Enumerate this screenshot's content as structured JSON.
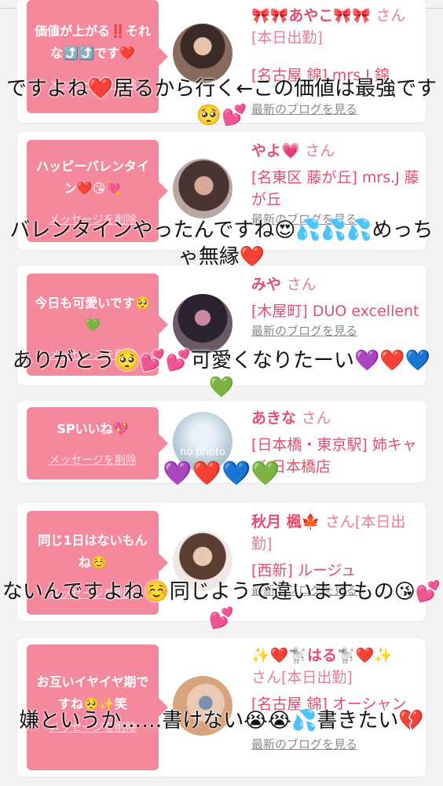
{
  "accent_color": "#f4899e",
  "link_color": "#e24e6f",
  "delete_label": "メッセージを削除",
  "blog_label": "最新のブログを見る",
  "cards": [
    {
      "message": "価値が上がる‼️それな⤴️⤴️です❤️",
      "name": "🎀🎀あやこ🎀🎀",
      "san": "さん[本日出勤]",
      "shop": "[名古屋 錦] mrs.J 錦",
      "overlay": "ですよね❤️居るから行く←この価値は最強です🥺💕"
    },
    {
      "message": "ハッピーバレンタイン❤️😘💘",
      "name": "やよ💗",
      "san": "さん",
      "shop": "[名東区 藤が丘] mrs.J 藤が丘",
      "overlay": "バレンタインやったんですね😍💦💦💦めっちゃ無縁❤️"
    },
    {
      "message": "今日も可愛いです🥺💚",
      "name": "みや",
      "san": "さん",
      "shop": "[木屋町] DUO excellent",
      "overlay": "ありがとう🥺💕💕可愛くなりたーい💜❤️💙💚"
    },
    {
      "message": "SPいいね💖",
      "name": "あきな",
      "san": "さん",
      "shop": "[日本橋・東京駅] 姉キャバ 日本橋店",
      "avatar_text": "no photo",
      "overlay": "💜❤️💙💚"
    },
    {
      "message": "同じ1日はないもんね☺️",
      "name": "秋月 楓🍁",
      "san": "さん[本日出勤]",
      "shop": "[西新] ルージュ",
      "overlay": "ないんですよね☺️同じようで違いますもの😘💕💕"
    },
    {
      "message": "お互いイヤイヤ期ですね🥺✨笑",
      "name": "✨❤️🐩はる🐩❤️✨",
      "san": "さん[本日出勤]",
      "shop": "[名古屋 錦] オーシャン",
      "overlay": "嫌というか……書けない😭😭💦書きたい💔"
    }
  ]
}
